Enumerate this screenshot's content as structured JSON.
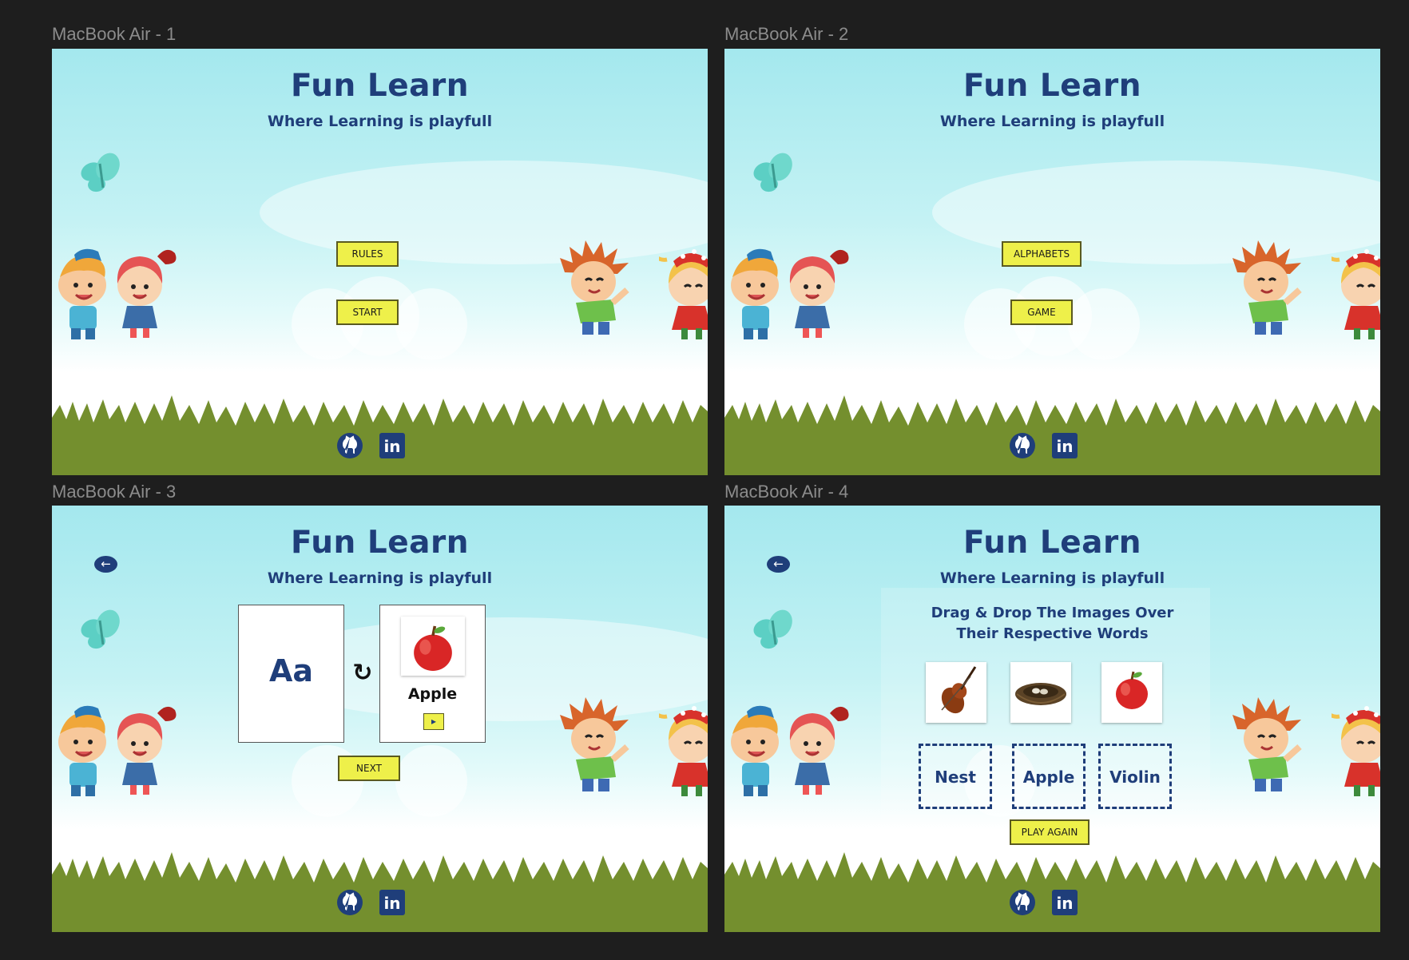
{
  "frames": [
    {
      "label": "MacBook Air - 1"
    },
    {
      "label": "MacBook Air - 2"
    },
    {
      "label": "MacBook Air - 3"
    },
    {
      "label": "MacBook Air - 4"
    }
  ],
  "app": {
    "title": "Fun Learn",
    "subtitle": "Where Learning is playfull"
  },
  "screen1": {
    "rules_label": "RULES",
    "start_label": "START"
  },
  "screen2": {
    "alphabets_label": "ALPHABETS",
    "game_label": "GAME"
  },
  "screen3": {
    "letter": "Aa",
    "word": "Apple",
    "next_label": "NEXT"
  },
  "screen4": {
    "instruction_line1": "Drag & Drop The Images Over",
    "instruction_line2": "Their Respective Words",
    "images": [
      "violin",
      "nest",
      "apple"
    ],
    "targets": [
      "Nest",
      "Apple",
      "Violin"
    ],
    "play_again_label": "PLAY AGAIN"
  },
  "footer": {
    "linkedin_text": "in"
  },
  "colors": {
    "accent": "#1f3e7a",
    "button_fill": "#eef04a",
    "grass": "#748f2e",
    "canvas": "#1e1e1e"
  }
}
